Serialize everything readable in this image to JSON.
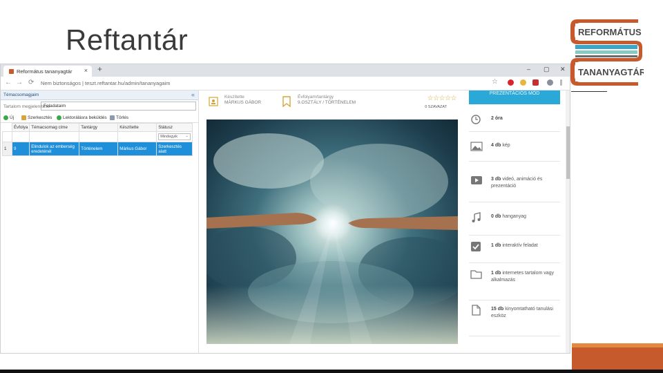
{
  "slide": {
    "title": "Reftantár",
    "logo_line1": "REFORMÁTUS",
    "logo_line2": "TANANYAGTÁR"
  },
  "browser": {
    "tab_title": "Református tananyagtár",
    "url": "Nem biztonságos | teszt.reftantar.hu/admin/tananyagaim"
  },
  "admin": {
    "panel_title": "Témacsomagjaim",
    "filter_label": "Tartalom megjelenítése",
    "filter_value": "Feladataim",
    "toolbar": {
      "new": "Új",
      "edit": "Szerkesztés",
      "send": "Lektorálásra beküldés",
      "delete": "Törlés"
    },
    "columns": [
      "Évfolya",
      "Témacsomag címe",
      "Tantárgy",
      "Készítette",
      "Státusz"
    ],
    "status_filter": "Mindegyik",
    "rows": [
      {
        "num": "1",
        "grade": "9",
        "title": "Elindulok az emberség eredeténél",
        "subject": "Történelem",
        "author": "Márkus Gábor",
        "status": "Szerkesztés alatt"
      }
    ]
  },
  "course": {
    "author_label": "Készítette",
    "author": "MÁRKUS GÁBOR",
    "subject_label": "Évfolyam/tantárgy",
    "subject": "9.OSZTÁLY / TÖRTÉNELEM",
    "rating_text": "0 SZAVAZAT",
    "rating_value": 0
  },
  "stats": {
    "button_label": "PREZENTÁCIÓS MÓD",
    "items": [
      {
        "icon": "clock-icon",
        "bold": "2 óra",
        "text": ""
      },
      {
        "icon": "image-icon",
        "bold": "4 db",
        "text": " kép"
      },
      {
        "icon": "video-icon",
        "bold": "3 db",
        "text": " videó, animáció és prezentáció"
      },
      {
        "icon": "music-icon",
        "bold": "0 db",
        "text": " hanganyag"
      },
      {
        "icon": "check-icon",
        "bold": "1 db",
        "text": " interaktív feladat"
      },
      {
        "icon": "folder-icon",
        "bold": "1 db",
        "text": " internetes tartalom vagy alkalmazás"
      },
      {
        "icon": "document-icon",
        "bold": "15 db",
        "text": " kinyomtatható tanulási eszköz"
      }
    ]
  },
  "colors": {
    "accent_orange": "#c65a2c",
    "accent_blue": "#2aa8d8",
    "selection_blue": "#1e8fd8"
  }
}
